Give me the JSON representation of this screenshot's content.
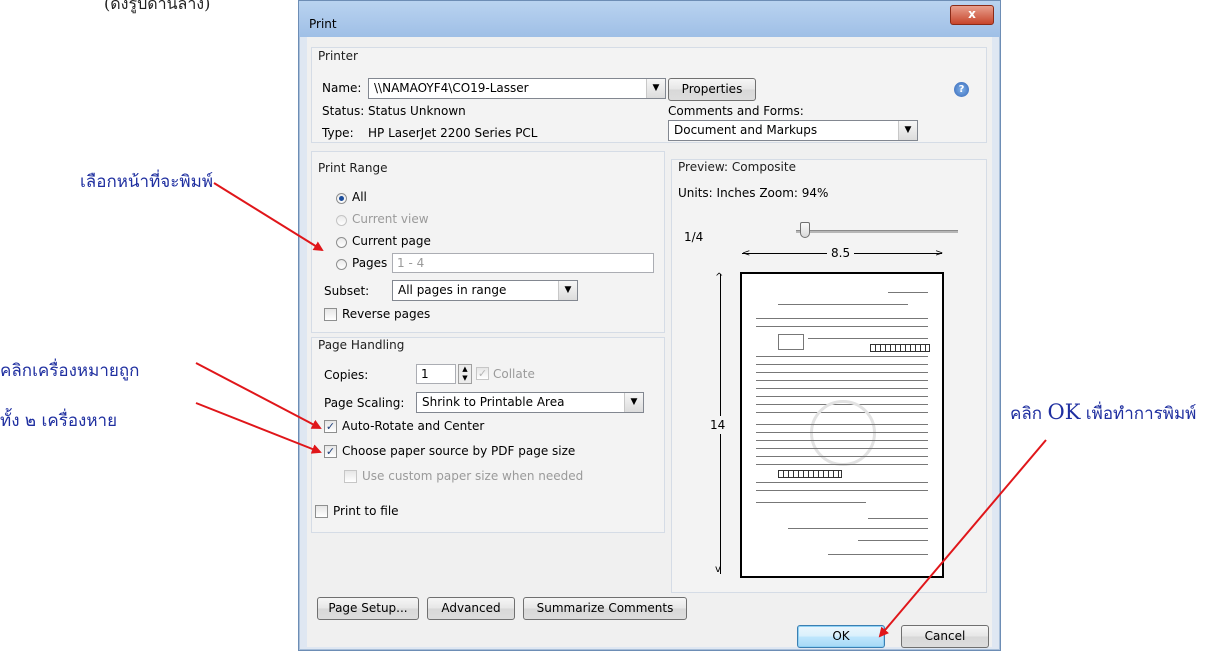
{
  "annotations": {
    "top_caption": "(ดังรูปด้านล่าง)",
    "select_pages": "เลือกหน้าที่จะพิมพ์",
    "click_check_line1": "คลิกเครื่องหมายถูก",
    "click_check_line2": "ทั้ง ๒ เครื่องหาย",
    "click_ok_prefix": "คลิก ",
    "click_ok_bold": "OK",
    "click_ok_suffix": " เพื่อทำการพิมพ์",
    "arrow_color": "#e0161a",
    "text_color": "#1f2fa0"
  },
  "dialog": {
    "title": "Print",
    "close_glyph": "x",
    "printer": {
      "group_title": "Printer",
      "name_label": "Name:",
      "name_value": "\\\\NAMAOYF4\\CO19-Lasser",
      "properties_label": "Properties",
      "help_glyph": "?",
      "status_label": "Status:",
      "status_value": "Status Unknown",
      "type_label": "Type:",
      "type_value": "HP LaserJet 2200 Series PCL",
      "comments_label": "Comments and Forms:",
      "comments_value": "Document and Markups"
    },
    "print_range": {
      "group_title": "Print Range",
      "all_label": "All",
      "current_view_label": "Current view",
      "current_page_label": "Current page",
      "pages_label": "Pages",
      "pages_value": "1 - 4",
      "subset_label": "Subset:",
      "subset_value": "All pages in range",
      "reverse_label": "Reverse pages"
    },
    "page_handling": {
      "group_title": "Page Handling",
      "copies_label": "Copies:",
      "copies_value": "1",
      "collate_label": "Collate",
      "scaling_label": "Page Scaling:",
      "scaling_value": "Shrink to Printable Area",
      "auto_rotate_label": "Auto-Rotate and Center",
      "choose_paper_label": "Choose paper source by PDF page size",
      "custom_paper_label": "Use custom paper size when needed"
    },
    "print_to_file_label": "Print to file",
    "preview": {
      "group_title": "Preview: Composite",
      "units_text": "Units: Inches Zoom:  94%",
      "page_indicator": "1/4",
      "width_value": "8.5",
      "height_value": "14"
    },
    "buttons": {
      "page_setup": "Page Setup...",
      "advanced": "Advanced",
      "summarize": "Summarize Comments",
      "ok": "OK",
      "cancel": "Cancel"
    }
  }
}
